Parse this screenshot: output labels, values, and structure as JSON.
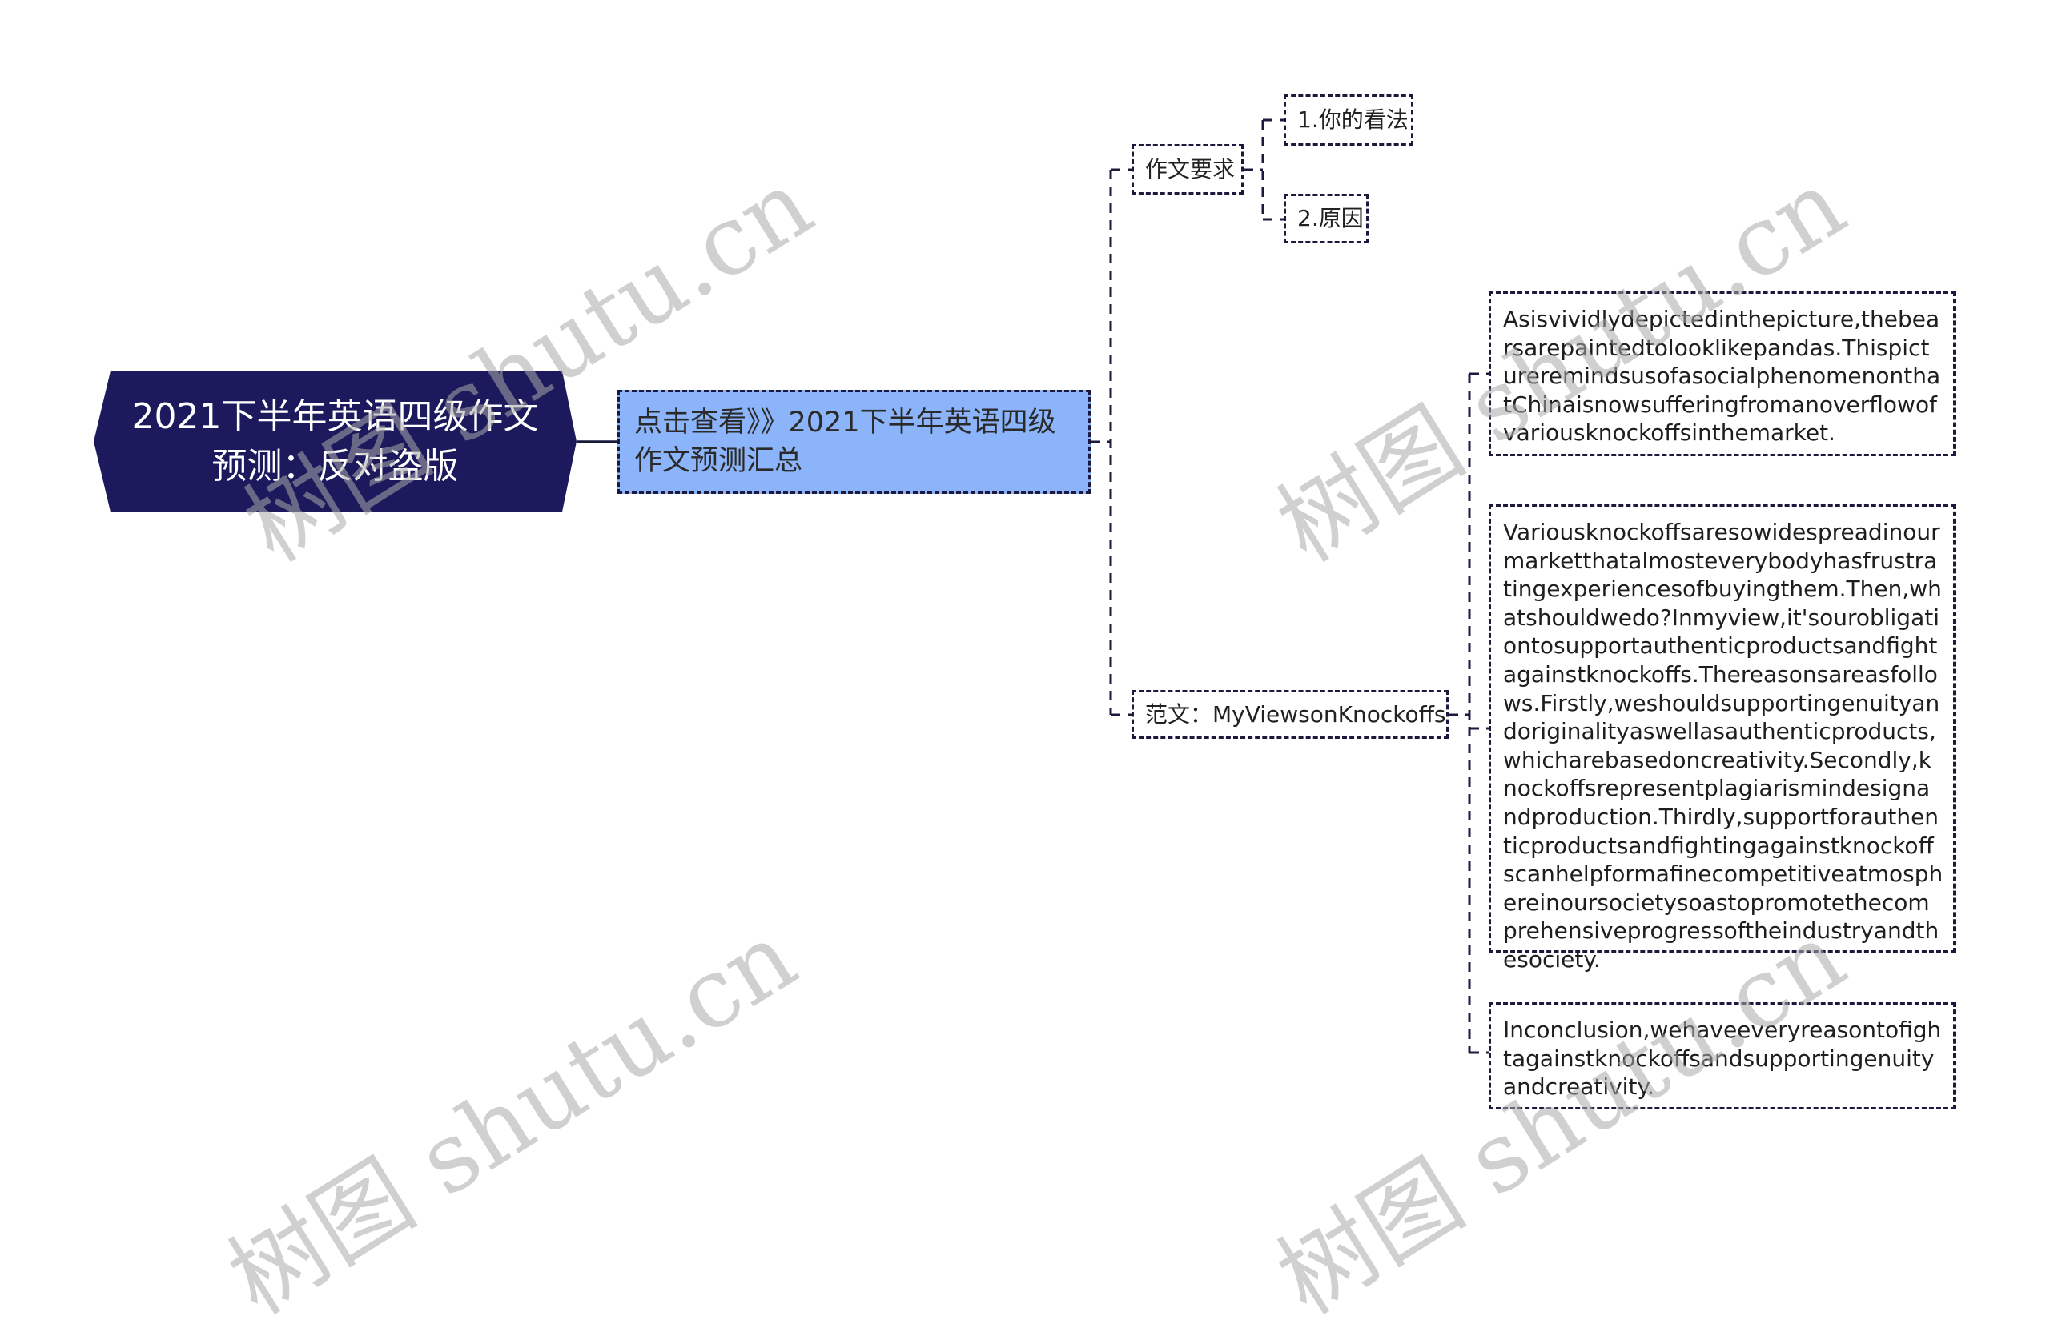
{
  "root": {
    "title": "2021下半年英语四级作文预测：反对盗版"
  },
  "hub": {
    "label": "点击查看》》2021下半年英语四级作文预测汇总"
  },
  "requirements": {
    "label": "作文要求",
    "children": [
      {
        "label": "1.你的看法"
      },
      {
        "label": "2.原因"
      }
    ]
  },
  "sample": {
    "label": "范文：MyViewsonKnockoffs",
    "paragraphs": [
      {
        "text": "Asisvividlydepictedinthepicture,thebearsarepaintedtolooklikepandas.ThispictureremindsusofasocialphenomenonthatChinaisnowsufferingfromanoverflowofvariousknockoffsinthemarket."
      },
      {
        "text": "Variousknockoffsaresowidespreadinourmarketthatalmosteverybodyhasfrustratingexperiencesofbuyingthem.Then,whatshouldwedo?Inmyview,it'sourobligationtosupportauthenticproductsandfightagainstknockoffs.Thereasonsareasfollows.Firstly,weshouldsupportingenuityandoriginalityaswellasauthenticproducts,whicharebasedoncreativity.Secondly,knockoffsrepresentplagiarismindesignandproduction.Thirdly,supportforauthenticproductsandfightingagainstknockoffscanhelpformafinecompetitiveatmosphereinoursocietysoastopromotethecomprehensiveprogressoftheindustryandthesociety."
      },
      {
        "text": "Inconclusion,wehaveeveryreasontofightagainstknockoffsandsupportingenuityandcreativity."
      }
    ]
  },
  "watermark": {
    "text": "树图 shutu.cn"
  },
  "colors": {
    "root_bg": "#1c1a5c",
    "hub_bg": "#8cb4fb",
    "line": "#1c1a3c"
  }
}
